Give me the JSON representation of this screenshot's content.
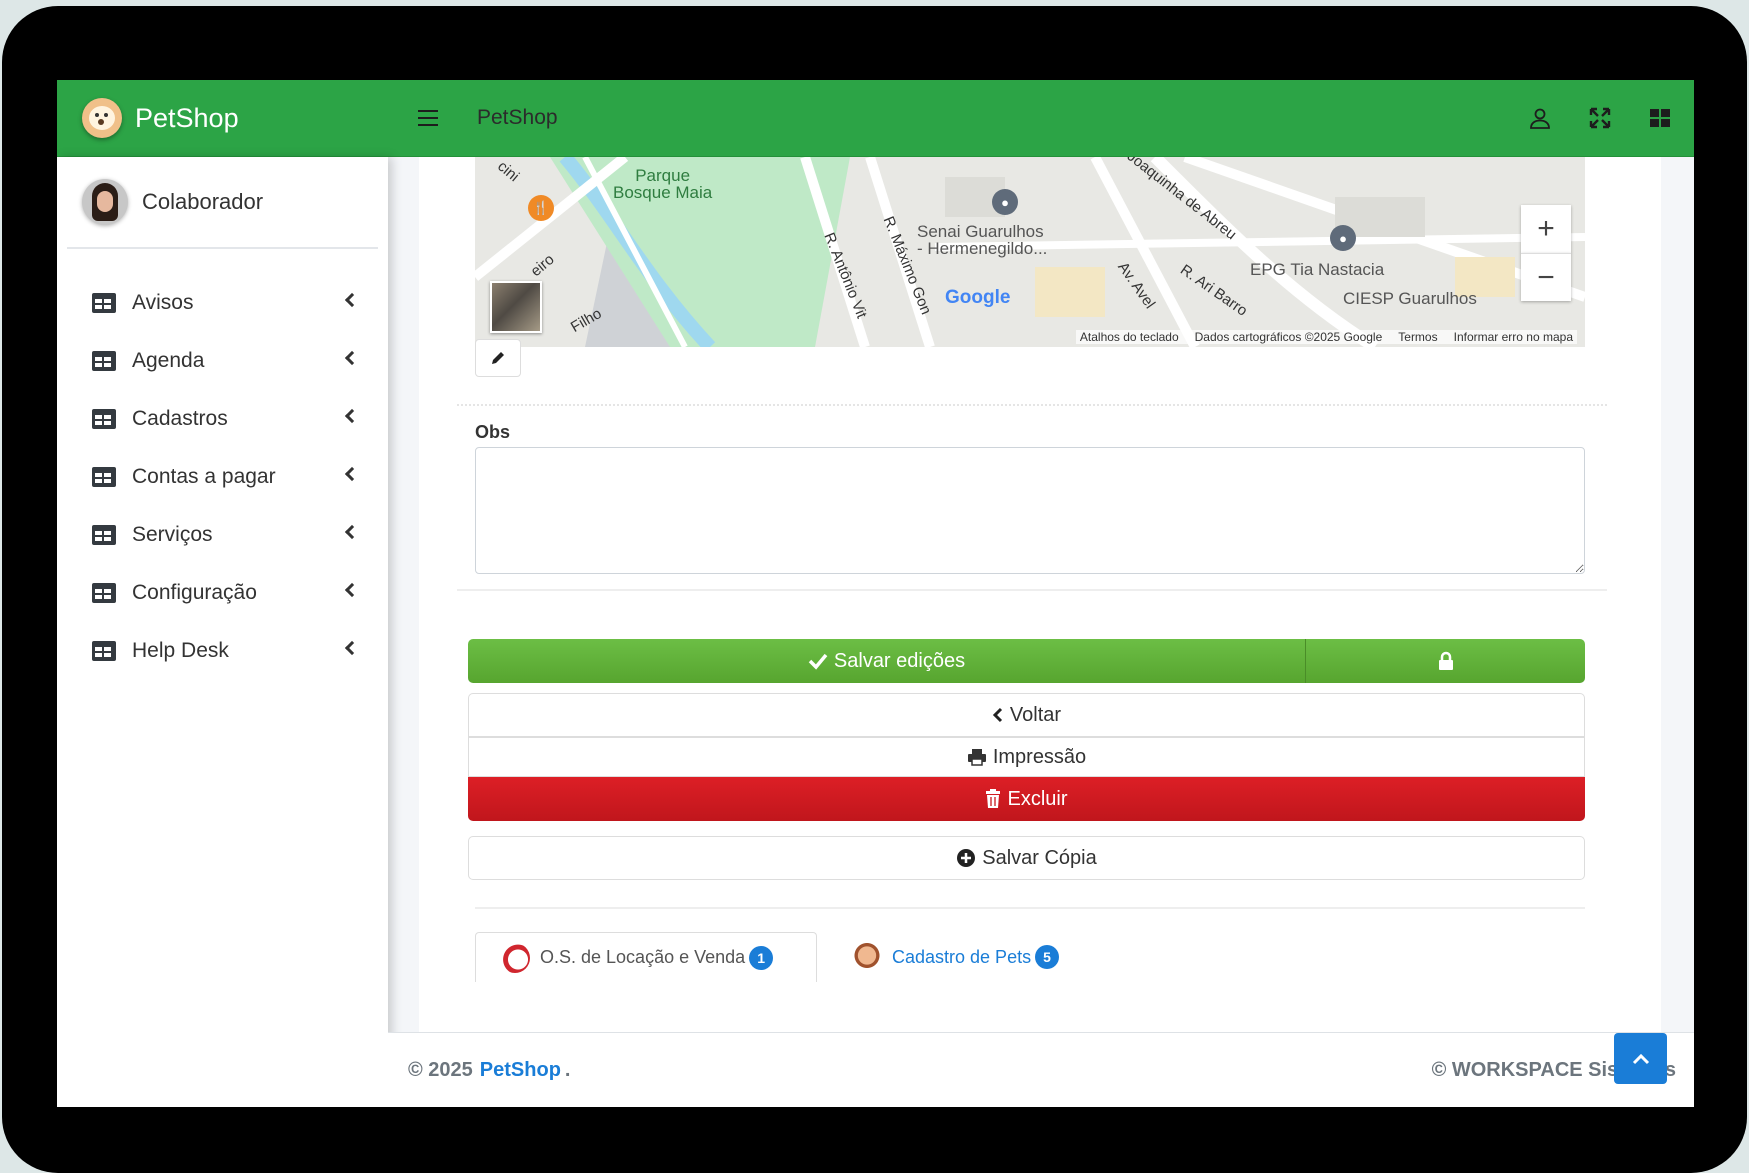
{
  "app": {
    "brand_name": "PetShop",
    "topbar_title": "PetShop"
  },
  "user": {
    "name": "Colaborador"
  },
  "sidebar": {
    "items": [
      {
        "label": "Avisos",
        "icon": "table-icon"
      },
      {
        "label": "Agenda",
        "icon": "table-icon"
      },
      {
        "label": "Cadastros",
        "icon": "table-icon"
      },
      {
        "label": "Contas a pagar",
        "icon": "table-icon"
      },
      {
        "label": "Serviços",
        "icon": "table-icon"
      },
      {
        "label": "Configuração",
        "icon": "table-icon"
      },
      {
        "label": "Help Desk",
        "icon": "table-icon"
      }
    ]
  },
  "topbar": {
    "icons": [
      "user-icon",
      "expand-icon",
      "grid-icon"
    ]
  },
  "map": {
    "labels": {
      "park": "Parque\nBosque Maia",
      "senai": "Senai Guarulhos\n- Hermenegildo...",
      "epg": "EPG Tia Nastacia",
      "ciesp": "CIESP Guarulhos",
      "street1": "R. Antônio Vit",
      "street2": "R. Máximo Gon",
      "street3": "Av. Avel",
      "street4": "R. Ari Barro",
      "street5": "Joaquinha de Abreu",
      "street6": "eiro",
      "street7": "Filho",
      "street8": "cini",
      "google": "Google"
    },
    "attribution": [
      "Atalhos do teclado",
      "Dados cartográficos ©2025 Google",
      "Termos",
      "Informar erro no mapa"
    ],
    "zoom_in": "+",
    "zoom_out": "−"
  },
  "form": {
    "obs_label": "Obs",
    "obs_value": ""
  },
  "buttons": {
    "save": "Salvar edições",
    "back": "Voltar",
    "print": "Impressão",
    "delete": "Excluir",
    "copy": "Salvar Cópia"
  },
  "tabs": [
    {
      "label": "O.S. de Locação e Venda",
      "badge": "1"
    },
    {
      "label": "Cadastro de Pets",
      "badge": "5"
    }
  ],
  "footer": {
    "copyright": "© 2025",
    "brand": "PetShop",
    "dot": ".",
    "right": "© WORKSPACE Sistemas"
  },
  "colors": {
    "primary_green": "#2ca446",
    "save_green": "#5fb136",
    "danger": "#c9191f",
    "link_blue": "#1a7dd7"
  }
}
